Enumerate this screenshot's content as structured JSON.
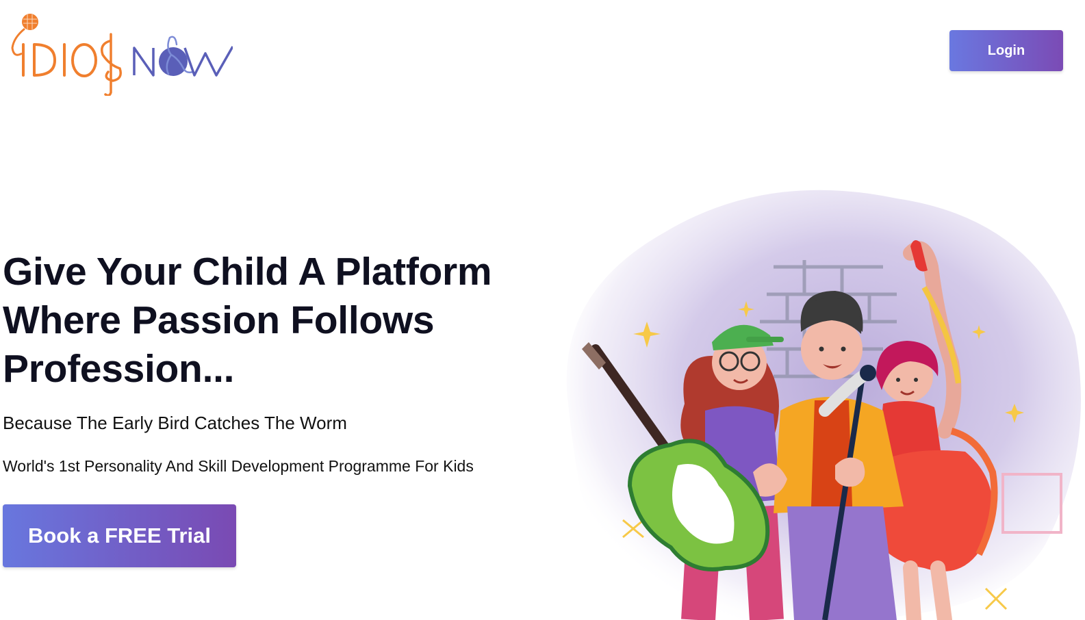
{
  "header": {
    "logo_text": "IDIOS NOW",
    "login_label": "Login"
  },
  "hero": {
    "title": "Give Your Child A Platform Where Passion Follows Profession...",
    "subtitle": "Because The Early Bird Catches The Worm",
    "description": "World's 1st Personality And Skill Development Programme For Kids",
    "cta_label": "Book a FREE Trial"
  },
  "colors": {
    "brand_orange": "#f07f2e",
    "brand_purple": "#5a5fb8",
    "button_gradient_start": "#6a78e0",
    "button_gradient_end": "#7b4bb5",
    "heading": "#0f1020"
  },
  "icons": {
    "logo": "idiosnow-logo",
    "hero_art": "kids-performing-illustration"
  }
}
